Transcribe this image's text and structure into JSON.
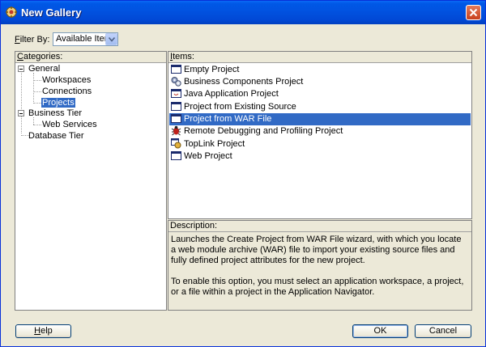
{
  "window": {
    "title": "New Gallery"
  },
  "filter": {
    "label_prefix": "F",
    "label_rest": "ilter By:",
    "selected": "Available Items"
  },
  "categories": {
    "header_prefix": "C",
    "header_rest": "ategories:",
    "tree": [
      {
        "label": "General"
      },
      {
        "label": "Workspaces"
      },
      {
        "label": "Connections"
      },
      {
        "label": "Projects"
      },
      {
        "label": "Business Tier"
      },
      {
        "label": "Web Services"
      },
      {
        "label": "Database Tier"
      }
    ]
  },
  "items": {
    "header_prefix": "I",
    "header_rest": "tems:",
    "list": [
      {
        "label": "Empty Project",
        "icon": "window-icon"
      },
      {
        "label": "Business Components Project",
        "icon": "gears-icon"
      },
      {
        "label": "Java Application Project",
        "icon": "java-app-icon"
      },
      {
        "label": "Project from Existing Source",
        "icon": "window-icon"
      },
      {
        "label": "Project from WAR File",
        "icon": "window-icon",
        "selected": true
      },
      {
        "label": "Remote Debugging and Profiling Project",
        "icon": "bug-icon"
      },
      {
        "label": "TopLink Project",
        "icon": "toplink-icon"
      },
      {
        "label": "Web Project",
        "icon": "window-icon"
      }
    ]
  },
  "description": {
    "header": "Description:",
    "para1": "Launches the Create Project from WAR File wizard, with which you locate a web module archive (WAR) file to import your existing source files and fully defined project attributes for the new project.",
    "para2": "To enable this option, you must select an application workspace, a project, or a file within a project in the Application Navigator."
  },
  "buttons": {
    "help_prefix": "H",
    "help_rest": "elp",
    "ok": "OK",
    "cancel": "Cancel"
  },
  "colors": {
    "selection": "#316ac5",
    "titlebar": "#0153e1",
    "dialog_bg": "#ece9d8"
  }
}
